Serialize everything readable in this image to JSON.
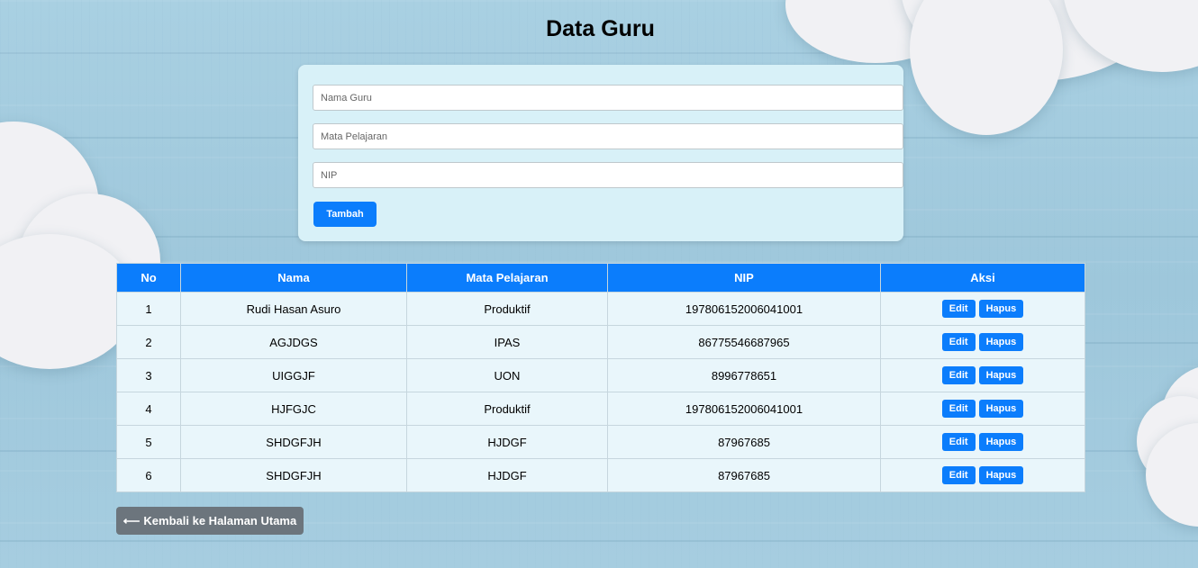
{
  "page": {
    "title": "Data Guru"
  },
  "form": {
    "nama_placeholder": "Nama Guru",
    "mapel_placeholder": "Mata Pelajaran",
    "nip_placeholder": "NIP",
    "submit_label": "Tambah"
  },
  "table": {
    "headers": [
      "No",
      "Nama",
      "Mata Pelajaran",
      "NIP",
      "Aksi"
    ],
    "rows": [
      {
        "no": "1",
        "nama": "Rudi Hasan Asuro",
        "mapel": "Produktif",
        "nip": "197806152006041001"
      },
      {
        "no": "2",
        "nama": "AGJDGS",
        "mapel": "IPAS",
        "nip": "86775546687965"
      },
      {
        "no": "3",
        "nama": "UIGGJF",
        "mapel": "UON",
        "nip": "8996778651"
      },
      {
        "no": "4",
        "nama": "HJFGJC",
        "mapel": "Produktif",
        "nip": "197806152006041001"
      },
      {
        "no": "5",
        "nama": "SHDGFJH",
        "mapel": "HJDGF",
        "nip": "87967685"
      },
      {
        "no": "6",
        "nama": "SHDGFJH",
        "mapel": "HJDGF",
        "nip": "87967685"
      }
    ],
    "edit_label": "Edit",
    "delete_label": "Hapus"
  },
  "footer": {
    "back_arrow": "⟵",
    "back_label": "Kembali ke Halaman Utama"
  },
  "colors": {
    "primary": "#0b7dfc",
    "secondary": "#6c757d",
    "card": "#d8f1f8",
    "row": "#e9f6fb"
  }
}
